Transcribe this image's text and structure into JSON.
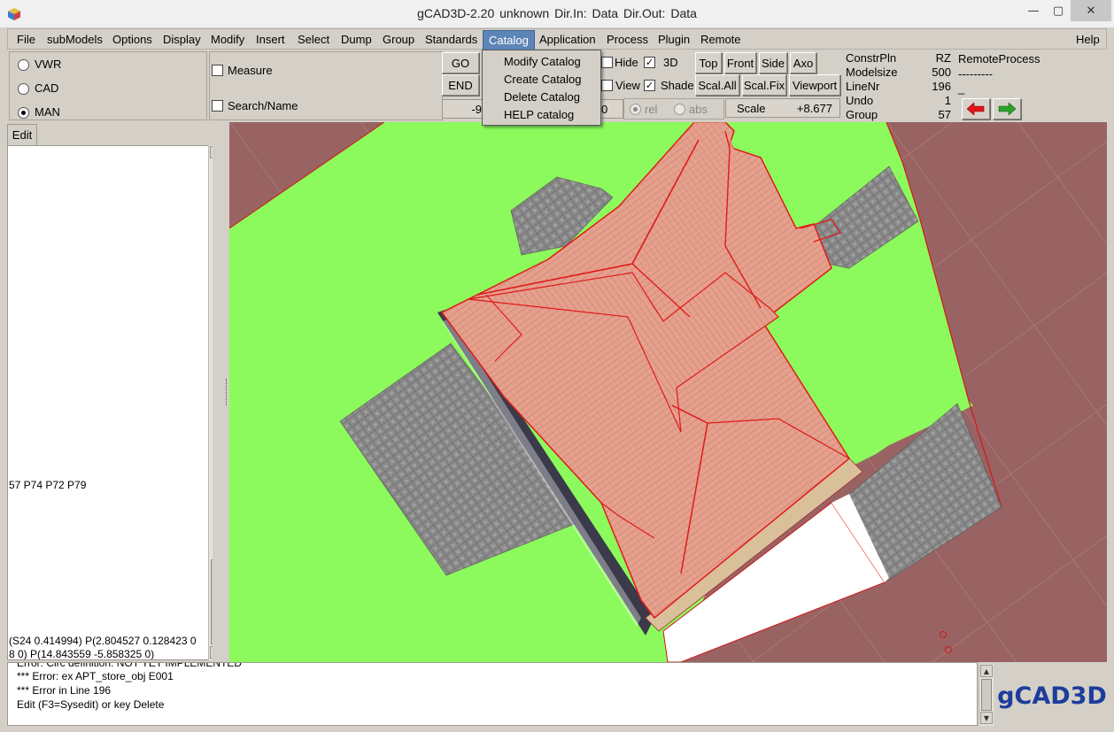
{
  "window": {
    "title": "gCAD3D-2.20   unknown    Dir.In: Data      Dir.Out: Data",
    "minimize": "—",
    "maximize": "▢",
    "close": "✕"
  },
  "menubar": {
    "items": [
      "File",
      "subModels",
      "Options",
      "Display",
      "Modify",
      "Insert",
      "Select",
      "Dump",
      "Group",
      "Standards",
      "Catalog",
      "Application",
      "Process",
      "Plugin",
      "Remote"
    ],
    "help": "Help",
    "active": "Catalog"
  },
  "catalog_menu": {
    "items": [
      "Modify Catalog",
      "Create Catalog",
      "Delete Catalog",
      "HELP catalog"
    ]
  },
  "mode": {
    "options": [
      "VWR",
      "CAD",
      "MAN"
    ],
    "selected": "MAN"
  },
  "tools": {
    "measure": "Measure",
    "search": "Search/Name",
    "go": "GO",
    "end": "END",
    "value_left": "-9",
    "value_right": "0"
  },
  "view_options": {
    "hide": "Hide",
    "hide_checked": false,
    "d3": "3D",
    "d3_checked": true,
    "view": "View",
    "view_checked": false,
    "shade": "Shade",
    "shade_checked": true
  },
  "view_buttons": [
    "Top",
    "Front",
    "Side",
    "Axo",
    "Scal.All",
    "Scal.Fix",
    "Viewport"
  ],
  "coords": {
    "rel": "rel",
    "abs": "abs",
    "scale_label": "Scale",
    "scale_value": "+8.677"
  },
  "status": {
    "labels": [
      "ConstrPln",
      "Modelsize",
      "LineNr",
      "Undo",
      "Group"
    ],
    "values": [
      "RZ",
      "500",
      "196",
      "1",
      "57"
    ],
    "remote_title": "RemoteProcess",
    "remote_line": "---------",
    "remote_cursor": "_"
  },
  "nav_colors": {
    "back": "#e0141c",
    "forward": "#2ea02e"
  },
  "edit_tab": "Edit",
  "editor": {
    "line_mid": "57 P74 P72 P79",
    "line_bottom1": "(S24 0.414994) P(2.804527 0.128423 0",
    "line_bottom2": "8 0) P(14.843559 -5.858325 0)"
  },
  "messages": {
    "lines": [
      "Error: Circ definition: NOT YET IMPLEMENTED",
      "*** Error: ex APT_store_obj E001",
      "*** Error in Line 196",
      "Edit (F3=Sysedit) or key Delete"
    ]
  },
  "logo_text": "gCAD3D",
  "colors": {
    "ground": "#8cfa5c",
    "plot": "#9a6363",
    "roof": "#e8a08c",
    "edge": "#e01a1a",
    "paving": "#8c8c8c"
  }
}
